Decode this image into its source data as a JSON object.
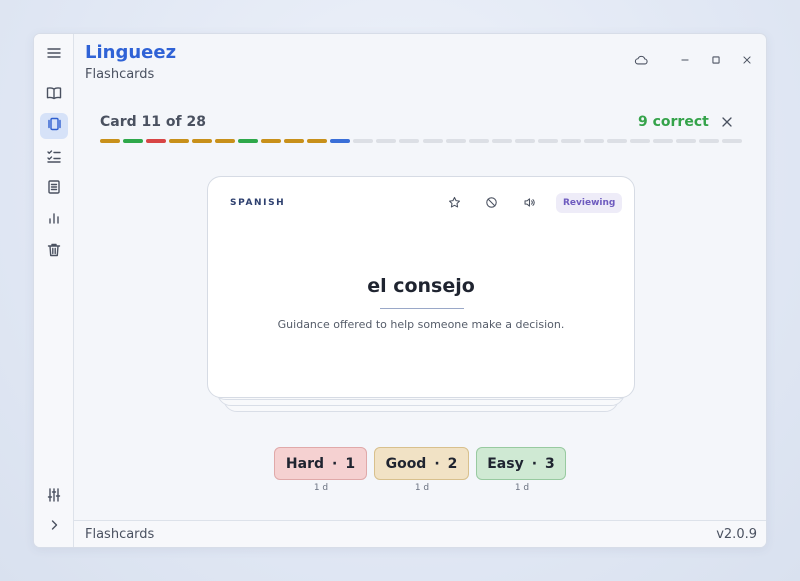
{
  "app": {
    "title": "Lingueez",
    "subtitle": "Flashcards"
  },
  "sidebar": {
    "items": [
      {
        "icon": "menu-icon"
      },
      {
        "icon": "book-icon"
      },
      {
        "icon": "cards-icon",
        "active": true
      },
      {
        "icon": "checklist-icon"
      },
      {
        "icon": "document-icon"
      },
      {
        "icon": "bar-chart-icon"
      },
      {
        "icon": "trash-icon"
      },
      {
        "icon": "sliders-icon"
      },
      {
        "icon": "chevron-right-icon"
      }
    ]
  },
  "window_controls": [
    "cloud-icon",
    "minimize-icon",
    "maximize-icon",
    "close-icon"
  ],
  "session": {
    "progress_text": "Card 11 of 28",
    "current_card": 11,
    "total_cards": 28,
    "correct_text": "9 correct",
    "segment_colors": {
      "good": "#c8901a",
      "easy": "#2ea84a",
      "hard": "#d84545",
      "current": "#3a6fd8",
      "pending": "#dcdfe5"
    },
    "segments": [
      "good",
      "easy",
      "hard",
      "good",
      "good",
      "good",
      "easy",
      "good",
      "good",
      "good",
      "current",
      "pending",
      "pending",
      "pending",
      "pending",
      "pending",
      "pending",
      "pending",
      "pending",
      "pending",
      "pending",
      "pending",
      "pending",
      "pending",
      "pending",
      "pending",
      "pending",
      "pending"
    ]
  },
  "card": {
    "language": "SPANISH",
    "status": "Reviewing",
    "word": "el consejo",
    "definition": "Guidance offered to help someone make a decision.",
    "icons": [
      "star-icon",
      "ban-icon",
      "speaker-icon"
    ]
  },
  "ratings": [
    {
      "label": "Hard",
      "key": "1",
      "interval": "1 d",
      "color": "#f5d1d1"
    },
    {
      "label": "Good",
      "key": "2",
      "interval": "1 d",
      "color": "#f1e2c5"
    },
    {
      "label": "Easy",
      "key": "3",
      "interval": "1 d",
      "color": "#cfe9d3"
    }
  ],
  "separator": "·",
  "footer": {
    "label": "Flashcards",
    "version": "v2.0.9"
  }
}
